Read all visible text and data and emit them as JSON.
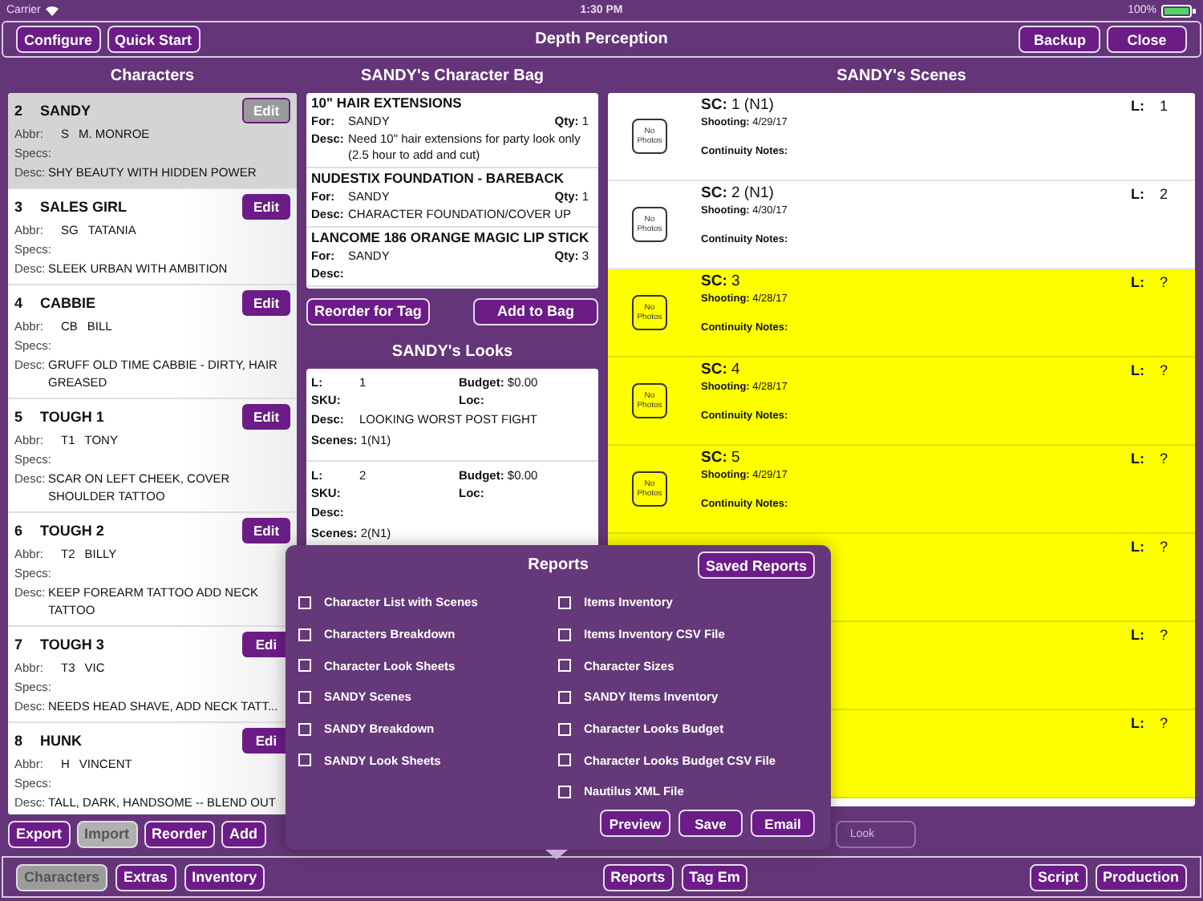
{
  "status_bar": {
    "carrier": "Carrier",
    "time": "1:30 PM",
    "battery": "100%"
  },
  "header": {
    "left_buttons": [
      "Configure",
      "Quick Start"
    ],
    "title": "Depth Perception",
    "right_buttons": [
      "Backup",
      "Close"
    ]
  },
  "characters": {
    "title": "Characters",
    "rows": [
      {
        "number": "2",
        "name": "SANDY",
        "selected": true,
        "edit": "Edit",
        "abbr_label": "Abbr:",
        "abbr": "S",
        "actor": "M. MONROE",
        "specs_label": "Specs:",
        "desc_label": "Desc:",
        "desc": "SHY BEAUTY WITH HIDDEN POWER"
      },
      {
        "number": "3",
        "name": "SALES GIRL",
        "selected": false,
        "edit": "Edit",
        "abbr_label": "Abbr:",
        "abbr": "SG",
        "actor": "TATANIA",
        "specs_label": "Specs:",
        "desc_label": "Desc:",
        "desc": "SLEEK URBAN WITH AMBITION"
      },
      {
        "number": "4",
        "name": "CABBIE",
        "selected": false,
        "edit": "Edit",
        "abbr_label": "Abbr:",
        "abbr": "CB",
        "actor": "BILL",
        "specs_label": "Specs:",
        "desc_label": "Desc:",
        "desc": "GRUFF OLD TIME CABBIE - DIRTY, HAIR GREASED"
      },
      {
        "number": "5",
        "name": "TOUGH 1",
        "selected": false,
        "edit": "Edit",
        "abbr_label": "Abbr:",
        "abbr": "T1",
        "actor": "TONY",
        "specs_label": "Specs:",
        "desc_label": "Desc:",
        "desc": "SCAR ON LEFT CHEEK, COVER SHOULDER TATTOO"
      },
      {
        "number": "6",
        "name": "TOUGH 2",
        "selected": false,
        "edit": "Edit",
        "abbr_label": "Abbr:",
        "abbr": "T2",
        "actor": "BILLY",
        "specs_label": "Specs:",
        "desc_label": "Desc:",
        "desc": "KEEP FOREARM TATTOO ADD NECK TATTOO"
      },
      {
        "number": "7",
        "name": "TOUGH 3",
        "selected": false,
        "edit": "Edi",
        "abbr_label": "Abbr:",
        "abbr": "T3",
        "actor": "VIC",
        "specs_label": "Specs:",
        "desc_label": "Desc:",
        "desc": "NEEDS HEAD SHAVE, ADD NECK TATT..."
      },
      {
        "number": "8",
        "name": "HUNK",
        "selected": false,
        "edit": "Edi",
        "abbr_label": "Abbr:",
        "abbr": "H",
        "actor": "VINCENT",
        "specs_label": "Specs:",
        "desc_label": "Desc:",
        "desc": "TALL, DARK, HANDSOME -- BLEND OUT"
      }
    ],
    "buttons": [
      {
        "label": "Export",
        "disabled": false
      },
      {
        "label": "Import",
        "disabled": true
      },
      {
        "label": "Reorder",
        "disabled": false
      },
      {
        "label": "Add",
        "disabled": false
      }
    ]
  },
  "bag": {
    "title": "SANDY's Character Bag",
    "items": [
      {
        "name": "10\" HAIR EXTENSIONS",
        "for_label": "For:",
        "for": "SANDY",
        "qty": "**Qty:** 1",
        "desc_label": "Desc:",
        "desc": "Need 10\" hair extensions for party look only (2.5 hour to add and cut)"
      },
      {
        "name": "NUDESTIX FOUNDATION - BAREBACK",
        "for_label": "For:",
        "for": "SANDY",
        "qty": "**Qty:** 1",
        "desc_label": "Desc:",
        "desc": "CHARACTER FOUNDATION/COVER UP"
      },
      {
        "name": "LANCOME 186 ORANGE MAGIC LIP STICK",
        "for_label": "For:",
        "for": "SANDY",
        "qty": "**Qty:** 3",
        "desc_label": "Desc:"
      }
    ],
    "buttons": [
      "Reorder for Tag",
      "Add to Bag"
    ]
  },
  "looks": {
    "title": "SANDY's Looks",
    "items": [
      {
        "l_label": "L:",
        "l": "1",
        "budget": "**Budget:** $0.00",
        "sku_label": "SKU:",
        "loc_label": "Loc:",
        "desc_label": "Desc:",
        "desc": "LOOKING WORST POST FIGHT",
        "scenes": "**Scenes:** 1(N1)"
      },
      {
        "l_label": "L:",
        "l": "2",
        "budget": "**Budget:** $0.00",
        "sku_label": "SKU:",
        "loc_label": "Loc:",
        "desc_label": "Desc:",
        "scenes": "**Scenes:** 2(N1)"
      }
    ]
  },
  "scenes": {
    "title": "SANDY's Scenes",
    "rows": [
      {
        "photo": "No Photos",
        "sc": "**SC:** 1 (N1)",
        "shooting": "**Shooting:** 4/29/17",
        "notes": "Continuity Notes:",
        "l_label": "L:",
        "l": "1",
        "highlighted": false
      },
      {
        "photo": "No Photos",
        "sc": "**SC:** 2 (N1)",
        "shooting": "**Shooting:** 4/30/17",
        "notes": "Continuity Notes:",
        "l_label": "L:",
        "l": "2",
        "highlighted": false
      },
      {
        "photo": "No Photos",
        "sc": "**SC:** 3",
        "shooting": "**Shooting:** 4/28/17",
        "notes": "Continuity Notes:",
        "l_label": "L:",
        "l": "?",
        "highlighted": true
      },
      {
        "photo": "No Photos",
        "sc": "**SC:** 4",
        "shooting": "**Shooting:** 4/28/17",
        "notes": "Continuity Notes:",
        "l_label": "L:",
        "l": "?",
        "highlighted": true
      },
      {
        "photo": "No Photos",
        "sc": "**SC:** 5",
        "shooting": "**Shooting:** 4/29/17",
        "notes": "Continuity Notes:",
        "l_label": "L:",
        "l": "?",
        "highlighted": true
      },
      {
        "l_label": "L:",
        "l": "?",
        "highlighted": true
      },
      {
        "l_label": "L:",
        "l": "?",
        "highlighted": true
      },
      {
        "l_label": "L:",
        "l": "?",
        "highlighted": true
      }
    ],
    "button": {
      "label": "Look",
      "disabled": true
    }
  },
  "reports": {
    "title": "Reports",
    "saved_button": "Saved Reports",
    "left": [
      {
        "label": "Character List with Scenes",
        "checked": false
      },
      {
        "label": "Characters Breakdown",
        "checked": false
      },
      {
        "label": "Character Look Sheets",
        "checked": false
      },
      {
        "label": "SANDY Scenes",
        "checked": false
      },
      {
        "label": "SANDY Breakdown",
        "checked": false
      },
      {
        "label": "SANDY Look Sheets",
        "checked": false
      }
    ],
    "right": [
      {
        "label": "Items Inventory",
        "checked": false
      },
      {
        "label": "Items Inventory CSV File",
        "checked": false
      },
      {
        "label": "Character Sizes",
        "checked": false
      },
      {
        "label": "SANDY Items Inventory",
        "checked": false
      },
      {
        "label": "Character Looks Budget",
        "checked": false
      },
      {
        "label": "Character Looks Budget CSV File",
        "checked": false
      },
      {
        "label": "Nautilus XML File",
        "checked": false
      }
    ],
    "buttons": [
      "Preview",
      "Save",
      "Email"
    ]
  },
  "toolbar": {
    "left": [
      {
        "label": "Characters",
        "selected": true
      },
      {
        "label": "Extras",
        "selected": false
      },
      {
        "label": "Inventory",
        "selected": false
      }
    ],
    "center": [
      {
        "label": "Reports",
        "selected": false
      },
      {
        "label": "Tag Em",
        "selected": false
      }
    ],
    "right": [
      {
        "label": "Script",
        "selected": false
      },
      {
        "label": "Production",
        "selected": false
      }
    ]
  }
}
